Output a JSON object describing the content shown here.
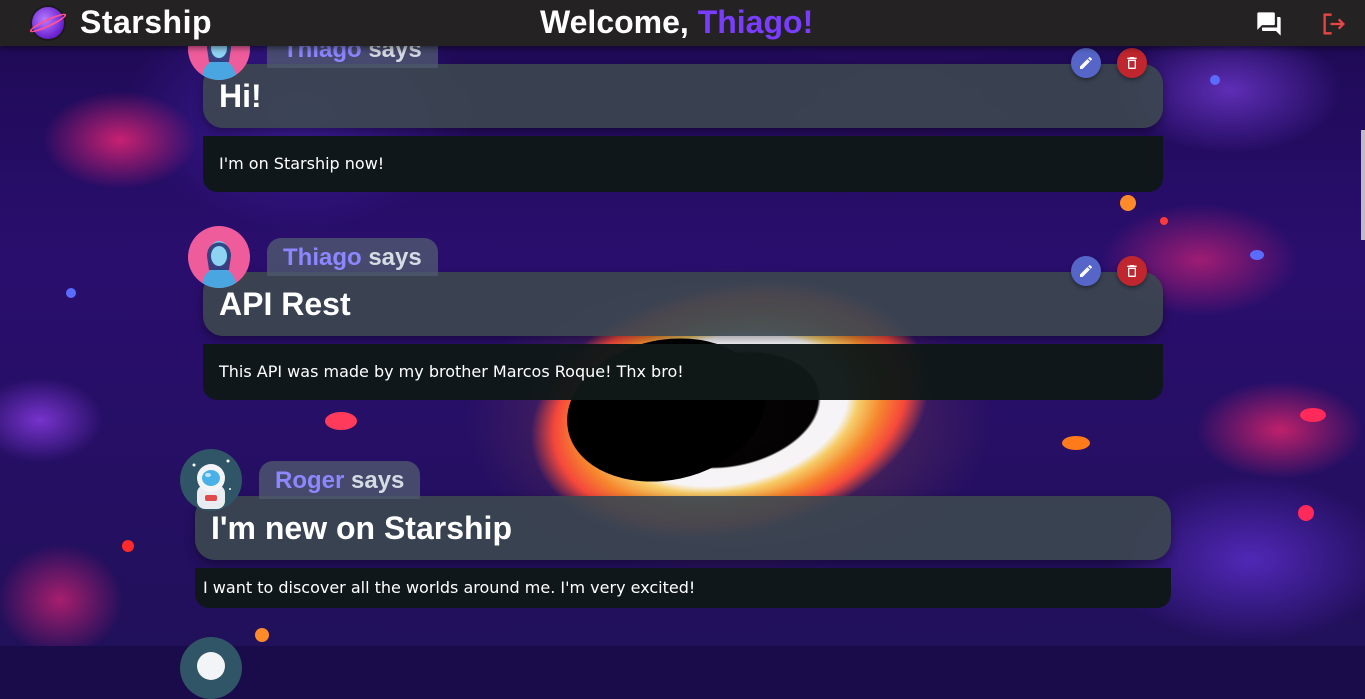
{
  "header": {
    "app_name": "Starship",
    "welcome_prefix": "Welcome, ",
    "username": "Thiago!",
    "icons": [
      "planet-logo-icon",
      "chat-bubbles-icon",
      "logout-icon"
    ],
    "accent_color": "#7a3cff"
  },
  "posts": [
    {
      "author": "Thiago",
      "says": "says",
      "title": "Hi!",
      "body": "I'm on Starship now!",
      "avatar": "woman-avatar",
      "editable": true
    },
    {
      "author": "Thiago",
      "says": "says",
      "title": "API Rest",
      "body": "This API was made by my brother Marcos Roque! Thx bro!",
      "avatar": "woman-avatar",
      "editable": true
    },
    {
      "author": "Roger",
      "says": "says",
      "title": "I'm new on Starship",
      "body": "I want to discover all the worlds around me. I'm very excited!",
      "avatar": "astronaut-avatar",
      "editable": false
    }
  ],
  "colors": {
    "edit_button": "#5566c8",
    "delete_button": "#c0262e",
    "author_name": "#8c86ff"
  }
}
